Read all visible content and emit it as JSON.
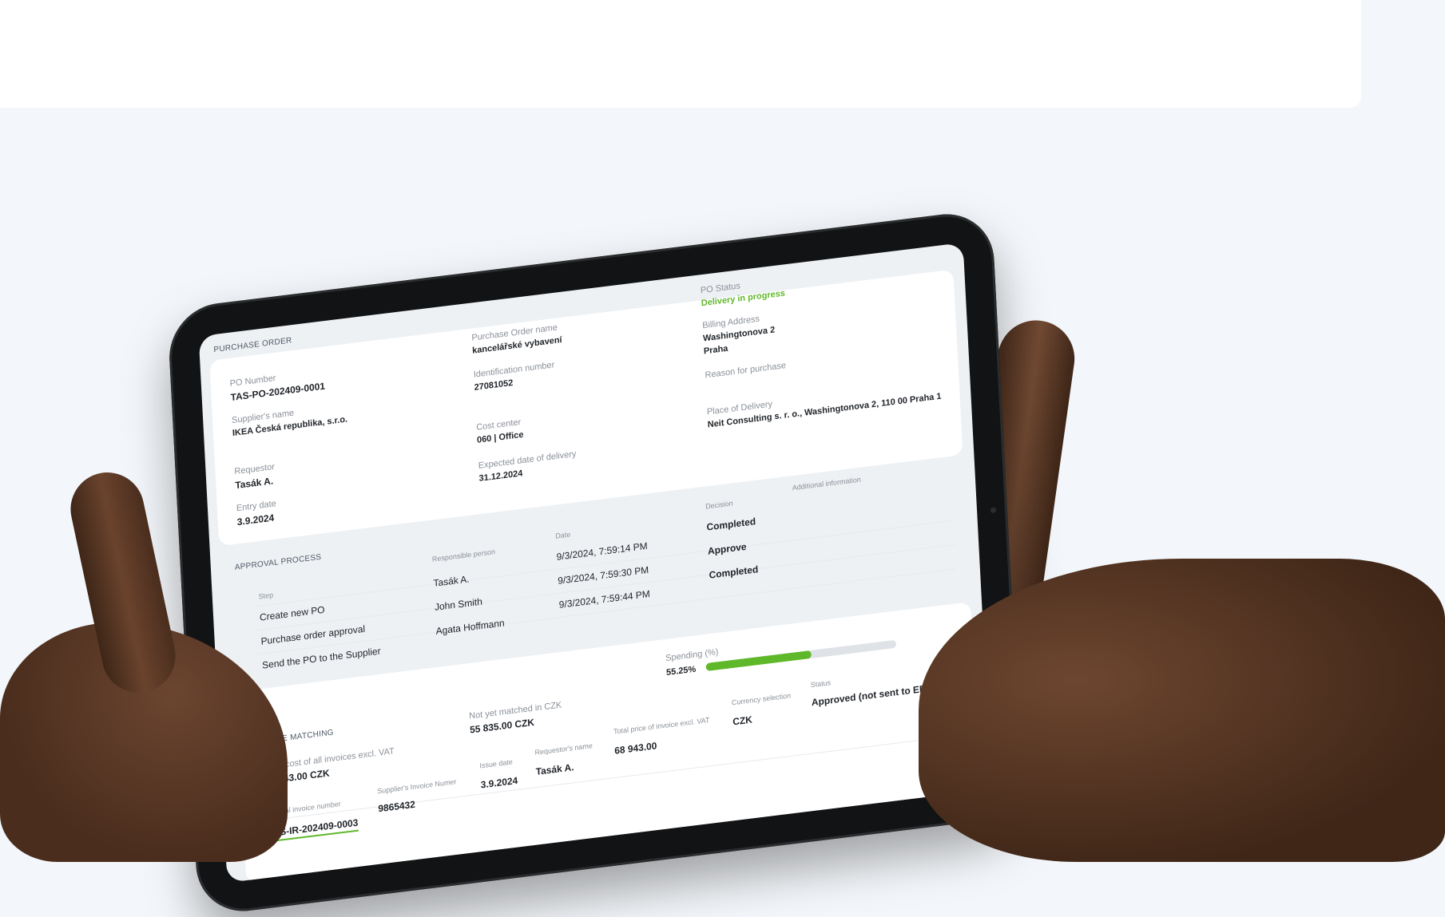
{
  "purchase_order": {
    "section_title": "PURCHASE ORDER",
    "po_number_label": "PO Number",
    "po_number": "TAS-PO-202409-0001",
    "supplier_label": "Supplier's name",
    "supplier": "IKEA Česká republika, s.r.o.",
    "requestor_label": "Requestor",
    "requestor": "Tasák A.",
    "entry_date_label": "Entry date",
    "entry_date": "3.9.2024",
    "po_name_label": "Purchase Order name",
    "po_name": "kancelářské vybavení",
    "identification_label": "Identification number",
    "identification": "27081052",
    "cost_center_label": "Cost center",
    "cost_center": "060 | Office",
    "expected_delivery_label": "Expected date of delivery",
    "expected_delivery": "31.12.2024",
    "po_status_label": "PO Status",
    "po_status": "Delivery in progress",
    "billing_address_label": "Billing Address",
    "billing_address_line1": "Washingtonova 2",
    "billing_address_line2": "Praha",
    "reason_label": "Reason for purchase",
    "place_of_delivery_label": "Place of Delivery",
    "place_of_delivery": "Neit Consulting s. r. o., Washingtonova 2, 110 00 Praha 1"
  },
  "approval_process": {
    "section_title": "APPROVAL PROCESS",
    "headers": {
      "step": "Step",
      "responsible": "Responsible person",
      "date": "Date",
      "decision": "Decision",
      "additional": "Additional information"
    },
    "rows": [
      {
        "step": "Create new PO",
        "responsible": "Tasák A.",
        "date": "9/3/2024, 7:59:14 PM",
        "decision": "Completed"
      },
      {
        "step": "Purchase order approval",
        "responsible": "John Smith",
        "date": "9/3/2024, 7:59:30 PM",
        "decision": "Approve"
      },
      {
        "step": "Send the PO to the Supplier",
        "responsible": "Agata Hoffmann",
        "date": "9/3/2024, 7:59:44 PM",
        "decision": "Completed"
      }
    ]
  },
  "invoice_matching": {
    "section_title": "INVOICE MATCHING",
    "total_cost_label": "Total cost of all invoices excl. VAT",
    "total_cost": "68 943.00 CZK",
    "not_matched_label": "Not yet matched in CZK",
    "not_matched": "55 835.00 CZK",
    "spending_label": "Spending (%)",
    "spending_value": "55.25%",
    "spending_fraction": 0.5525,
    "headers": {
      "internal_invoice": "Internal invoice number",
      "supplier_invoice": "Supplier's Invoice Numer",
      "issue_date": "Issue date",
      "requestor": "Requestor's name",
      "total_price": "Total price of invoice excl. VAT",
      "currency": "Currency selection",
      "status": "Status"
    },
    "rows": [
      {
        "internal_invoice": "TAS-IR-202409-0003",
        "supplier_invoice": "9865432",
        "issue_date": "3.9.2024",
        "requestor": "Tasák A.",
        "total_price": "68 943.00",
        "currency": "CZK",
        "status": "Approved (not sent to ERP)"
      }
    ]
  },
  "colors": {
    "accent_green": "#5fb82a",
    "tablet_bezel": "#121314",
    "page_background": "#f3f6fa"
  }
}
